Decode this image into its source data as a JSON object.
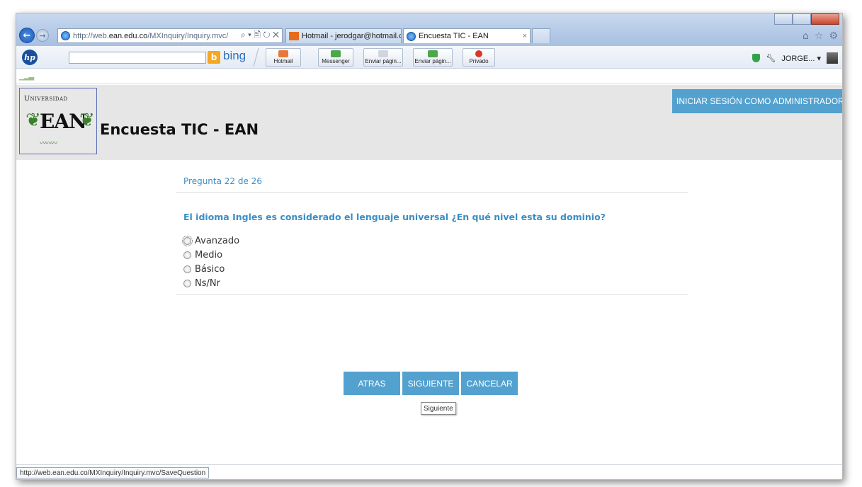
{
  "browser": {
    "address_prefix": "http://web.",
    "address_domain": "ean.edu.co",
    "address_path": "/MXInquiry/Inquiry.mvc/",
    "address_tools": "⌕ ▾ 🖹 ↻ ✕",
    "tabs": [
      {
        "label": "Hotmail - jerodgar@hotmail.c...",
        "active": false
      },
      {
        "label": "Encuesta TIC - EAN",
        "active": true
      }
    ],
    "tab_close": "×",
    "back_glyph": "←",
    "forward_glyph": "→",
    "chrome_icons": [
      "home-icon",
      "star-icon",
      "gear-icon"
    ],
    "toolbar_close": "x",
    "bing_label": "bing",
    "toolbar_buttons": [
      {
        "label": "Hotmail",
        "icon": "hotmail-icon",
        "color": "#e8783a"
      },
      {
        "label": "Messenger",
        "icon": "messenger-icon",
        "color": "#4ca64c"
      },
      {
        "label": "Enviar págin...",
        "icon": "send-page-icon",
        "color": "#cfd6df"
      },
      {
        "label": "Enviar págin...",
        "icon": "send-page-messenger-icon",
        "color": "#4ca64c"
      },
      {
        "label": "Privado",
        "icon": "private-icon",
        "color": "#d9372a"
      }
    ],
    "user_label": "JORGE...",
    "user_caret": "▾",
    "status_url": "http://web.ean.edu.co/MXInquiry/Inquiry.mvc/SaveQuestion"
  },
  "site": {
    "logo_text_top": "Universidad",
    "logo_text_main": "EAN",
    "title": "Encuesta TIC - EAN",
    "admin_button": "INICIAR SESIÓN COMO ADMINISTRADOR",
    "accent_color": "#53a1cf",
    "link_color": "#3a8ec6"
  },
  "survey": {
    "progress": "Pregunta 22 de 26",
    "question": "El idioma Ingles es considerado el lenguaje universal ¿En qué nivel esta su dominio?",
    "options": [
      {
        "label": "Avanzado",
        "selected": false,
        "focused": true
      },
      {
        "label": "Medio",
        "selected": false,
        "focused": false
      },
      {
        "label": "Básico",
        "selected": false,
        "focused": false
      },
      {
        "label": "Ns/Nr",
        "selected": false,
        "focused": false
      }
    ],
    "buttons": {
      "back": "ATRAS",
      "next": "SIGUIENTE",
      "cancel": "CANCELAR"
    },
    "tooltip": "Siguiente"
  }
}
